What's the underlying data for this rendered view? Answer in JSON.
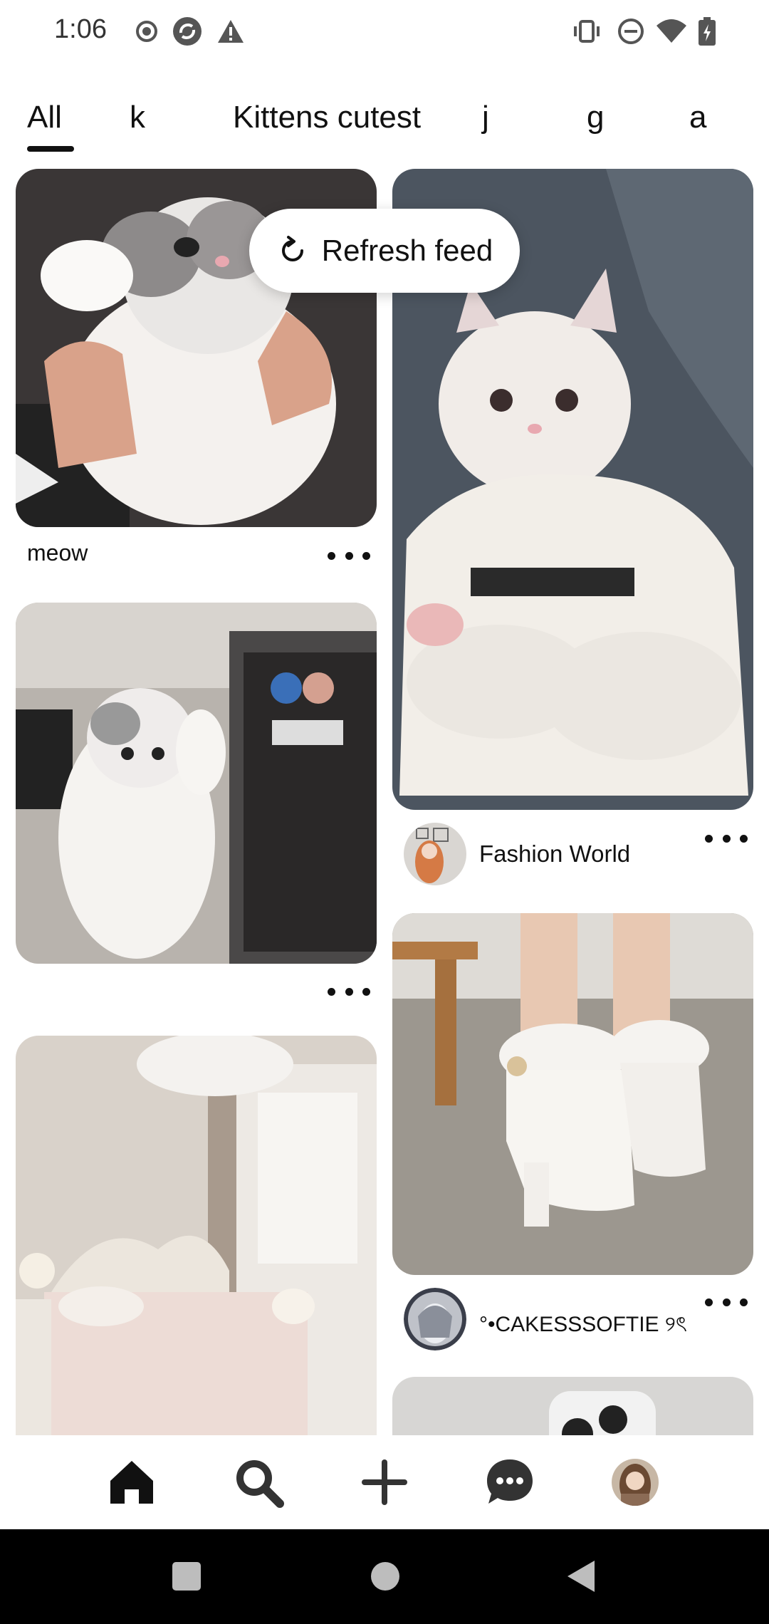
{
  "status_bar": {
    "time": "1:06",
    "icons_left": [
      "record-icon",
      "sync-icon",
      "warning-icon"
    ],
    "icons_right": [
      "vibrate-icon",
      "do-not-disturb-icon",
      "wifi-icon",
      "battery-icon"
    ]
  },
  "tabs": [
    {
      "label": "All",
      "selected": true
    },
    {
      "label": "k",
      "selected": false
    },
    {
      "label": "Kittens cutest",
      "selected": false
    },
    {
      "label": "j",
      "selected": false
    },
    {
      "label": "g",
      "selected": false
    },
    {
      "label": "a",
      "selected": false
    }
  ],
  "refresh": {
    "label": "Refresh feed"
  },
  "pins": {
    "left": [
      {
        "title": "meow"
      },
      {
        "title": ""
      },
      {
        "title": ""
      }
    ],
    "right": [
      {
        "author": "Fashion World"
      },
      {
        "author": "°•CAKESSSOFTIE ୨ৎ"
      },
      {
        "author": ""
      }
    ]
  },
  "bottom_nav": [
    "home-icon",
    "search-icon",
    "create-icon",
    "messages-icon",
    "profile-avatar"
  ],
  "colors": {
    "text": "#111111",
    "background": "#ffffff",
    "system_nav": "#000000"
  }
}
